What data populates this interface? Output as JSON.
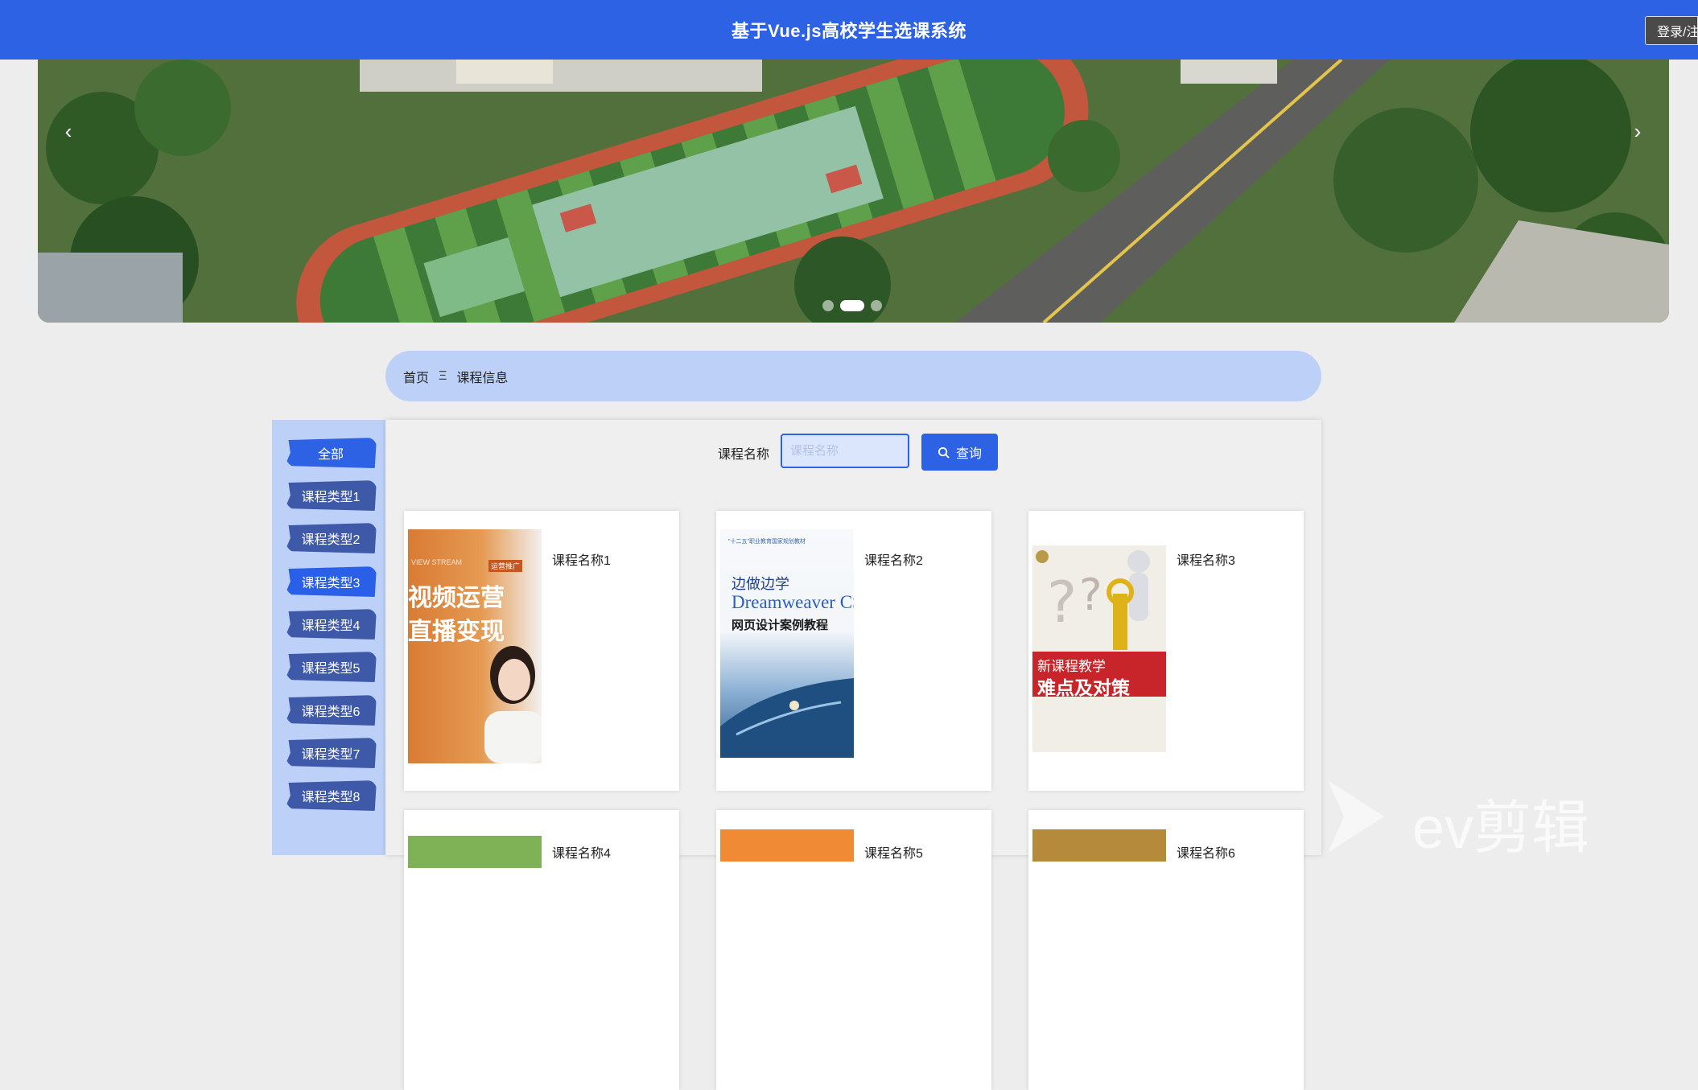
{
  "header": {
    "title": "基于Vue.js高校学生选课系统",
    "login_label": "登录/注册"
  },
  "carousel": {
    "prev_label": "‹",
    "next_label": "›",
    "dots": 3,
    "active_dot": 1
  },
  "breadcrumb": {
    "home": "首页",
    "separator": "Ξ",
    "current": "课程信息"
  },
  "sidebar": {
    "items": [
      {
        "label": "全部"
      },
      {
        "label": "课程类型1"
      },
      {
        "label": "课程类型2"
      },
      {
        "label": "课程类型3"
      },
      {
        "label": "课程类型4"
      },
      {
        "label": "课程类型5"
      },
      {
        "label": "课程类型6"
      },
      {
        "label": "课程类型7"
      },
      {
        "label": "课程类型8"
      }
    ]
  },
  "search": {
    "label": "课程名称",
    "placeholder": "课程名称",
    "button_label": "查询"
  },
  "cards": [
    {
      "name": "课程名称1",
      "cover_lines": [
        "视频运营",
        "直播变现"
      ],
      "cover_tag": "运营推广",
      "cover_top": "VIEW STREAM"
    },
    {
      "name": "课程名称2",
      "cover_lines": [
        "边做边学",
        "Dreamweaver CS",
        "网页设计案例教程"
      ],
      "cover_top": "\"十二五\"职业教育国家规划教材"
    },
    {
      "name": "课程名称3",
      "cover_lines": [
        "新课程教学",
        "难点及对策"
      ]
    },
    {
      "name": "课程名称4"
    },
    {
      "name": "课程名称5"
    },
    {
      "name": "课程名称6"
    }
  ],
  "watermark": "ev剪辑",
  "colors": {
    "primary": "#2d62e5",
    "sidebar_bg": "#bcd0f8",
    "category": "#3f59a9"
  }
}
